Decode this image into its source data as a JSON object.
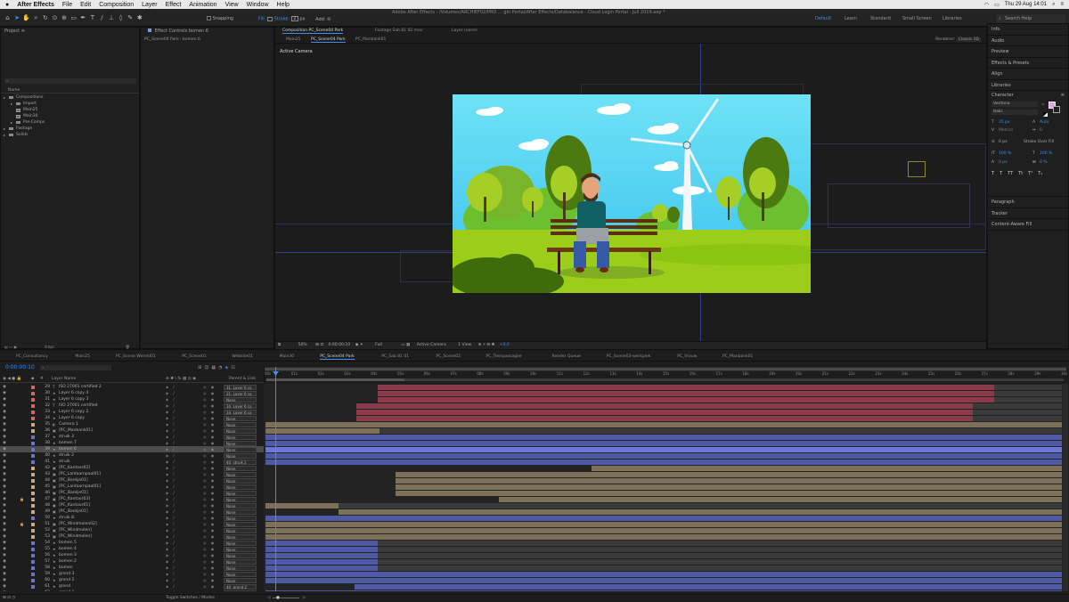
{
  "menubar": {
    "apple": "",
    "app_name": "After Effects",
    "items": [
      "File",
      "Edit",
      "Composition",
      "Layer",
      "Effect",
      "Animation",
      "View",
      "Window",
      "Help"
    ],
    "right": {
      "clock": "Thu 29 Aug  14:01"
    }
  },
  "window_title": "Adobe After Effects - /Volumes/ARCHIEF02/PRO ... gin Portal/After Effects/Databalance - Cloud Login Portal - Juli 2019.aep *",
  "toolbar": {
    "snapping_label": "Snapping",
    "fill_label": "Fill:",
    "stroke_label": "Stroke:",
    "stroke_value": "2",
    "stroke_unit": "px",
    "add_label": "Add:"
  },
  "workspaces": [
    {
      "label": "Default",
      "active": true
    },
    {
      "label": "Learn",
      "active": false
    },
    {
      "label": "Standard",
      "active": false
    },
    {
      "label": "Small Screen",
      "active": false
    },
    {
      "label": "Libraries",
      "active": false
    }
  ],
  "search_help_placeholder": "Search Help",
  "project_panel": {
    "title": "Project",
    "col_name": "Name",
    "tree": [
      {
        "label": "Compositions",
        "type": "folder",
        "indent": 0
      },
      {
        "label": "Import",
        "type": "folder",
        "indent": 1
      },
      {
        "label": "Main25",
        "type": "comp",
        "indent": 1
      },
      {
        "label": "Main30",
        "type": "comp",
        "indent": 1
      },
      {
        "label": "Pre-Comps",
        "type": "folder",
        "indent": 1
      },
      {
        "label": "Footage",
        "type": "folder",
        "indent": 0
      },
      {
        "label": "Solids",
        "type": "folder",
        "indent": 0
      }
    ],
    "bpc": "8 bpc"
  },
  "effect_controls": {
    "tab": "Effect Controls bomen 6",
    "subtitle": "PC_Scene04 Park · bomen 6"
  },
  "viewer": {
    "tabs": [
      "Composition PC_Scene04 Park",
      "Footage Sab 81 02.mov",
      "Layer (none)"
    ],
    "sub_tabs": [
      "Main25",
      "PC_Scene04 Park",
      "PC_Manbank01"
    ],
    "renderer_label": "Renderer:",
    "renderer_value": "Classic 3D",
    "active_camera_label": "Active Camera",
    "footer": {
      "zoom": "50%",
      "timecode": "0:00:00:10",
      "resolution": "Full",
      "camera": "Active Camera",
      "views": "1 View",
      "exposure": "+0,0"
    }
  },
  "right_panels": {
    "top_items": [
      "Info",
      "Audio",
      "Preview",
      "Effects & Presets",
      "Align",
      "Libraries"
    ],
    "character": {
      "title": "Character",
      "font": "Verdana",
      "style": "Italic",
      "size": "35 px",
      "leading": "Auto",
      "kerning": "Metrics",
      "tracking": "0",
      "stroke_width": "0 px",
      "stroke_mode": "Stroke Over Fill",
      "v_scale": "100 %",
      "h_scale": "100 %",
      "baseline": "0 px",
      "tsume": "0 %",
      "styles": [
        "T",
        "T",
        "TT",
        "Tt",
        "T¹",
        "T₁"
      ]
    },
    "bottom_items": [
      "Paragraph",
      "Tracker",
      "Content-Aware Fill"
    ]
  },
  "timeline": {
    "tabs": [
      "PC_Consultancy",
      "Main25",
      "PC_Scene Wereld01",
      "PC_Scene01",
      "Website01",
      "Main30",
      "PC_Scene04 Park",
      "PC_Sab 81 01",
      "PC_Scene02",
      "PC_Treinpassagier",
      "Render Queue",
      "PC_Scene03-werkplek",
      "PC_Vrouw",
      "PC_Manbank01"
    ],
    "active_tab": "PC_Scene04 Park",
    "timecode": "0:00:00:10",
    "col_layer_name": "Layer Name",
    "col_parent": "Parent & Link",
    "ruler": [
      "00s",
      "01s",
      "02s",
      "03s",
      "04s",
      "05s",
      "06s",
      "07s",
      "08s",
      "09s",
      "10s",
      "11s",
      "12s",
      "13s",
      "14s",
      "15s",
      "16s",
      "17s",
      "18s",
      "19s",
      "20s",
      "21s",
      "22s",
      "23s",
      "24s",
      "25s",
      "26s",
      "27s",
      "28s",
      "29s",
      "30s"
    ],
    "footer": "Toggle Switches / Modes",
    "layers": [
      {
        "num": "29",
        "name": "ISO 27001 certified 2",
        "parent": "31. Layer 6 co",
        "color": "#c86a6a",
        "type": "T"
      },
      {
        "num": "30",
        "name": "Layer 6 copy 4",
        "parent": "31. Layer 6 co",
        "color": "#c86a6a",
        "type": "★"
      },
      {
        "num": "31",
        "name": "Layer 6 copy 3",
        "parent": "None",
        "color": "#c86a6a",
        "type": "★"
      },
      {
        "num": "32",
        "name": "ISO 27001 certified",
        "parent": "34. Layer 6 co",
        "color": "#c86a6a",
        "type": "T"
      },
      {
        "num": "33",
        "name": "Layer 6 copy 2",
        "parent": "34. Layer 6 co",
        "color": "#c86a6a",
        "type": "★"
      },
      {
        "num": "34",
        "name": "Layer 6 copy",
        "parent": "None",
        "color": "#c86a6a",
        "type": "★"
      },
      {
        "num": "35",
        "name": "Camera 1",
        "parent": "None",
        "color": "#c9a983",
        "type": "◐"
      },
      {
        "num": "36",
        "name": "[PC_Manbank01]",
        "parent": "None",
        "color": "#c9a983",
        "type": "▣"
      },
      {
        "num": "37",
        "name": "struik 3",
        "parent": "None",
        "color": "#6a74c2",
        "type": "★"
      },
      {
        "num": "38",
        "name": "bomen 7",
        "parent": "None",
        "color": "#6a74c2",
        "type": "★"
      },
      {
        "num": "39",
        "name": "bomen 6",
        "parent": "None",
        "color": "#6a74c2",
        "type": "★"
      },
      {
        "num": "40",
        "name": "struik 2",
        "parent": "None",
        "color": "#6a74c2",
        "type": "★"
      },
      {
        "num": "41",
        "name": "struik",
        "parent": "40. struik 2",
        "color": "#6a74c2",
        "type": "★"
      },
      {
        "num": "42",
        "name": "[PC_Kantoor02]",
        "parent": "None",
        "color": "#c9a983",
        "type": "▣"
      },
      {
        "num": "43",
        "name": "[PC_Lantaarnpaal01]",
        "parent": "None",
        "color": "#c9a983",
        "type": "▣"
      },
      {
        "num": "44",
        "name": "[PC_Bankje01]",
        "parent": "None",
        "color": "#c9a983",
        "type": "▣"
      },
      {
        "num": "45",
        "name": "[PC_Lantaarnpaal01]",
        "parent": "None",
        "color": "#c9a983",
        "type": "▣"
      },
      {
        "num": "46",
        "name": "[PC_Bankje01]",
        "parent": "None",
        "color": "#c9a983",
        "type": "▣"
      },
      {
        "num": "47",
        "name": "[PC_Kantoor03]",
        "parent": "None",
        "color": "#c9a983",
        "type": "▣"
      },
      {
        "num": "48",
        "name": "[PC_Kantoor01]",
        "parent": "None",
        "color": "#c9a983",
        "type": "▣"
      },
      {
        "num": "49",
        "name": "[PC_Bankje01]",
        "parent": "None",
        "color": "#c9a983",
        "type": "▣"
      },
      {
        "num": "50",
        "name": "struik 8",
        "parent": "None",
        "color": "#6a74c2",
        "type": "★"
      },
      {
        "num": "51",
        "name": "[PC_Windmolen02]",
        "parent": "None",
        "color": "#c9a983",
        "type": "▣"
      },
      {
        "num": "52",
        "name": "[PC_Windmolen]",
        "parent": "None",
        "color": "#c9a983",
        "type": "▣"
      },
      {
        "num": "53",
        "name": "[PC_Windmolen]",
        "parent": "None",
        "color": "#c9a983",
        "type": "▣"
      },
      {
        "num": "54",
        "name": "bomen 5",
        "parent": "None",
        "color": "#6a74c2",
        "type": "★"
      },
      {
        "num": "55",
        "name": "bomen 4",
        "parent": "None",
        "color": "#6a74c2",
        "type": "★"
      },
      {
        "num": "56",
        "name": "bomen 3",
        "parent": "None",
        "color": "#6a74c2",
        "type": "★"
      },
      {
        "num": "57",
        "name": "bomen 2",
        "parent": "None",
        "color": "#6a74c2",
        "type": "★"
      },
      {
        "num": "58",
        "name": "bomen",
        "parent": "None",
        "color": "#6a74c2",
        "type": "★"
      },
      {
        "num": "59",
        "name": "grond 3",
        "parent": "None",
        "color": "#6a74c2",
        "type": "★"
      },
      {
        "num": "60",
        "name": "grond 2",
        "parent": "None",
        "color": "#6a74c2",
        "type": "★"
      },
      {
        "num": "61",
        "name": "grond",
        "parent": "40. grond 2",
        "color": "#6a74c2",
        "type": "★"
      },
      {
        "num": "62",
        "name": "grond 1",
        "parent": "None",
        "color": "#6a74c2",
        "type": "★"
      }
    ]
  }
}
